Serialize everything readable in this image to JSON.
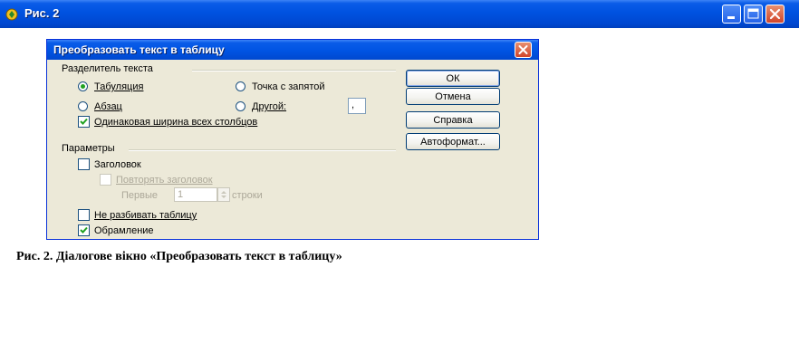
{
  "window": {
    "title": "Рис. 2"
  },
  "dialog": {
    "title": "Преобразовать текст в таблицу",
    "separator_group": {
      "label": "Разделитель текста",
      "options": {
        "tab": "Табуляция",
        "semicolon": "Точка с запятой",
        "paragraph": "Абзац",
        "other": "Другой:",
        "other_value": ","
      },
      "selected": "tab",
      "equal_width": {
        "label": "Одинаковая ширина всех столбцов",
        "checked": true
      }
    },
    "params_group": {
      "label": "Параметры",
      "header": {
        "label": "Заголовок",
        "checked": false
      },
      "repeat_header": {
        "label": "Повторять заголовок",
        "checked": false,
        "disabled": true
      },
      "first_label": "Первые",
      "first_value": "1",
      "rows_label": "строки",
      "no_split": {
        "label": "Не разбивать таблицу",
        "checked": false
      },
      "border": {
        "label": "Обрамление",
        "checked": true
      }
    },
    "buttons": {
      "ok": "ОК",
      "cancel": "Отмена",
      "help": "Справка",
      "autoformat": "Автоформат..."
    }
  },
  "caption": "Рис. 2. Діалогове вікно «Преобразовать текст в таблицу»",
  "colors": {
    "title_blue": "#0054e3",
    "dialog_bg": "#ece9d8",
    "check_green": "#21a121",
    "close_red": "#d1452a"
  }
}
